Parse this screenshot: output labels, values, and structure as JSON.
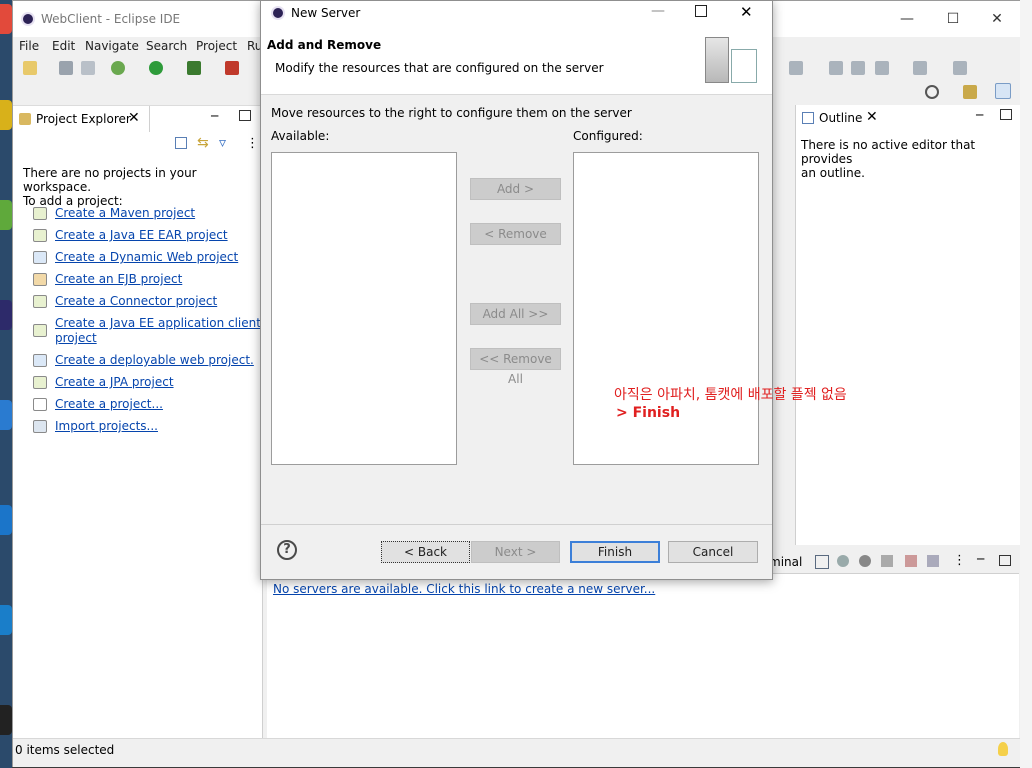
{
  "window": {
    "title": "WebClient - Eclipse IDE",
    "menu": [
      "File",
      "Edit",
      "Navigate",
      "Search",
      "Project",
      "Ru"
    ]
  },
  "project_explorer": {
    "tab_label": "Project Explorer",
    "empty_text_line1": "There are no projects in your workspace.",
    "empty_text_line2": "To add a project:",
    "links": [
      {
        "label": "Create a Maven project"
      },
      {
        "label": "Create a Java EE EAR project"
      },
      {
        "label": "Create a Dynamic Web project"
      },
      {
        "label": "Create an EJB project"
      },
      {
        "label": "Create a Connector project"
      },
      {
        "label": "Create a Java EE application client",
        "label2": "project"
      },
      {
        "label": "Create a deployable web project."
      },
      {
        "label": "Create a JPA project"
      },
      {
        "label": "Create a project..."
      },
      {
        "label": "Import projects..."
      }
    ]
  },
  "outline": {
    "tab_label": "Outline",
    "message_line1": "There is no active editor that provides",
    "message_line2": "an outline."
  },
  "servers": {
    "tab_label_fragment": "minal",
    "link_text": "No servers are available. Click this link to create a new server..."
  },
  "status": {
    "left": "0 items selected"
  },
  "dialog": {
    "title": "New Server",
    "header_title": "Add and Remove",
    "header_desc": "Modify the resources that are configured on the server",
    "instruction": "Move resources to the right to configure them on the server",
    "available_label": "Available:",
    "configured_label": "Configured:",
    "buttons": {
      "add": "Add >",
      "remove": "< Remove",
      "add_all": "Add All >>",
      "remove_all": "<< Remove All",
      "back": "< Back",
      "next": "Next >",
      "finish": "Finish",
      "cancel": "Cancel"
    },
    "help": "?"
  },
  "annotation": {
    "line1": "아직은 아파치, 톰캣에 배포할 플젝 없음",
    "line2": "> Finish"
  },
  "colors": {
    "link": "#0645ad",
    "annotation": "#e02020",
    "finish_border": "#3c7fd8"
  }
}
